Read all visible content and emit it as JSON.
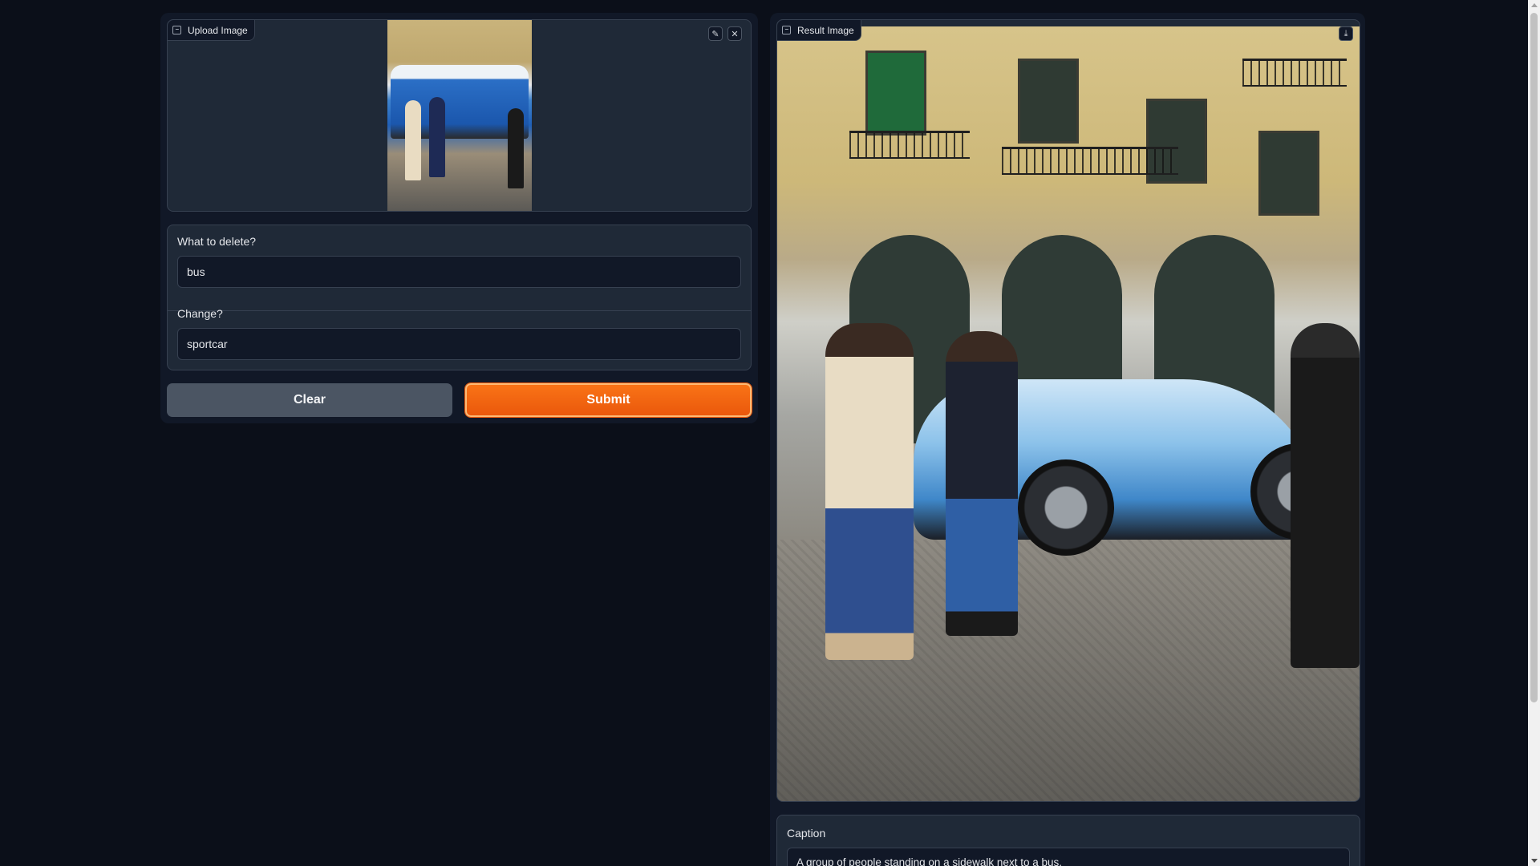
{
  "upload": {
    "label": "Upload Image",
    "edit_icon": "pencil-icon",
    "close_icon": "close-icon"
  },
  "form": {
    "delete_label": "What to delete?",
    "delete_value": "bus",
    "change_label": "Change?",
    "change_value": "sportcar"
  },
  "buttons": {
    "clear_label": "Clear",
    "submit_label": "Submit"
  },
  "result": {
    "label": "Result Image",
    "download_icon": "download-icon"
  },
  "caption": {
    "label": "Caption",
    "text": "A group of people standing on a sidewalk next to a bus."
  },
  "colors": {
    "background": "#0b0f19",
    "panel": "#1f2937",
    "accent": "#f97316",
    "secondary_button": "#4b5563"
  }
}
